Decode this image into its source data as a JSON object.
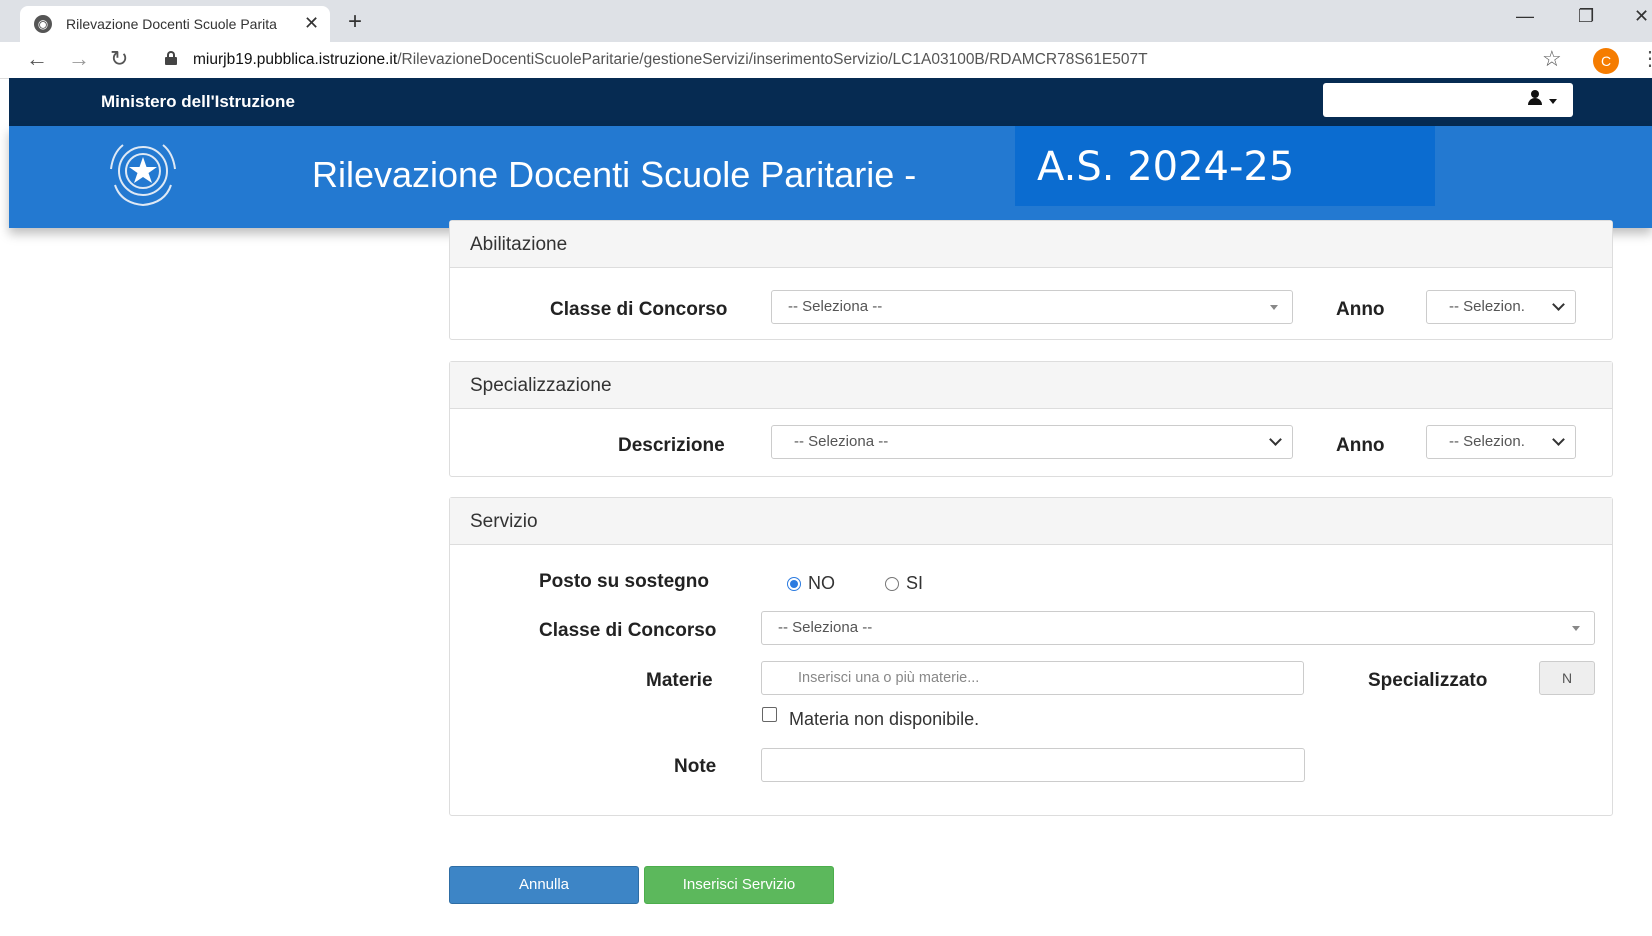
{
  "browser": {
    "tab_title": "Rilevazione Docenti Scuole Parita",
    "url_host": "miurjb19.pubblica.istruzione.it",
    "url_path": "/RilevazioneDocentiScuoleParitarie/gestioneServizi/inserimentoServizio/LC1A03100B/RDAMCR78S61E507T",
    "profile_initial": "C",
    "annotation_text": "(...)"
  },
  "header": {
    "ministry": "Ministero dell'Istruzione",
    "site_title": "Rilevazione Docenti Scuole Paritarie -",
    "school_year": "A.S. 2024-25"
  },
  "abilitazione": {
    "title": "Abilitazione",
    "classe_label": "Classe di Concorso",
    "classe_value": "-- Seleziona --",
    "anno_label": "Anno",
    "anno_value": "-- Selezion."
  },
  "specializzazione": {
    "title": "Specializzazione",
    "descrizione_label": "Descrizione",
    "descrizione_value": "-- Seleziona --",
    "anno_label": "Anno",
    "anno_value": "-- Selezion."
  },
  "servizio": {
    "title": "Servizio",
    "sostegno_label": "Posto su sostegno",
    "radio_no": "NO",
    "radio_si": "SI",
    "classe_label": "Classe di Concorso",
    "classe_value": "-- Seleziona --",
    "materie_label": "Materie",
    "materie_placeholder": "Inserisci una o più materie...",
    "specializzato_label": "Specializzato",
    "specializzato_value": "N",
    "materia_non_disponibile": "Materia non disponibile.",
    "note_label": "Note"
  },
  "buttons": {
    "annulla": "Annulla",
    "inserisci": "Inserisci Servizio"
  },
  "colors": {
    "top_band": "#062b52",
    "blue_band": "#2379d1",
    "cancel_button": "#3d85c6",
    "submit_button": "#5cb85c"
  }
}
